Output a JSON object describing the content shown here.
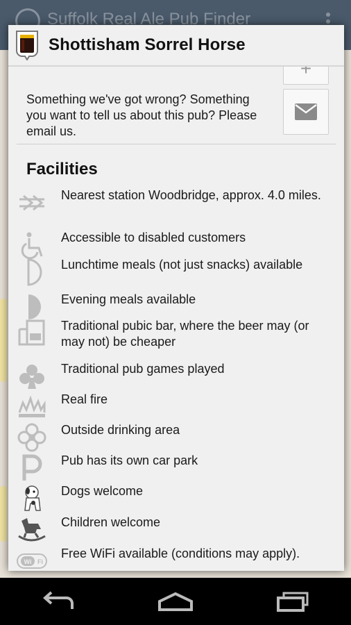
{
  "background": {
    "app_title": "Suffolk Real Ale Pub Finder"
  },
  "dialog": {
    "title": "Shottisham Sorrel Horse",
    "plus_label": "+",
    "feedback_text": "Something we've got wrong? Something you want to tell us about this pub? Please email us.",
    "facilities_heading": "Facilities",
    "facilities": [
      {
        "icon": "train-icon",
        "label": "Nearest station Woodbridge, approx. 4.0 miles."
      },
      {
        "icon": "wheelchair-icon",
        "label": "Accessible to disabled customers"
      },
      {
        "icon": "half-moon-outline-icon",
        "label": "Lunchtime meals (not just snacks) available"
      },
      {
        "icon": "half-moon-filled-icon",
        "label": "Evening meals available"
      },
      {
        "icon": "public-bar-icon",
        "label": "Traditional pubic bar, where the beer may (or may not) be cheaper"
      },
      {
        "icon": "club-icon",
        "label": "Traditional pub games played"
      },
      {
        "icon": "fire-icon",
        "label": "Real fire"
      },
      {
        "icon": "flower-icon",
        "label": "Outside drinking area"
      },
      {
        "icon": "parking-icon",
        "label": "Pub has its own car park"
      },
      {
        "icon": "dog-icon",
        "label": "Dogs welcome"
      },
      {
        "icon": "rocking-horse-icon",
        "label": "Children welcome"
      },
      {
        "icon": "wifi-icon",
        "label": "Free WiFi available (conditions may apply)."
      }
    ]
  },
  "navbar": {
    "buttons": [
      "back",
      "home",
      "recent-apps"
    ]
  },
  "colors": {
    "dialog_bg": "#f0f0f0",
    "icon_grey": "#bdbdbd",
    "navbar_bg": "#000000"
  }
}
